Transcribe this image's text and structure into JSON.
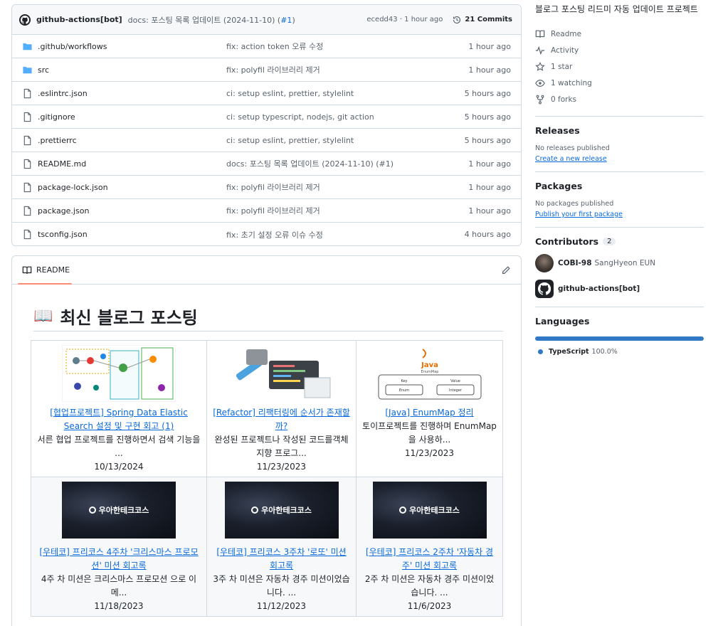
{
  "commit": {
    "author": "github-actions[bot]",
    "message": "docs: 포스팅 목록 업데이트 (2024-11-10) (",
    "pr": "#1",
    "message_end": ")",
    "hash_time": "ecedd43 · 1 hour ago",
    "commits_label": "21 Commits"
  },
  "files": [
    {
      "name": ".github/workflows",
      "type": "folder",
      "message": "fix: action token 오류 수정",
      "time": "1 hour ago"
    },
    {
      "name": "src",
      "type": "folder",
      "message": "fix: polyfil 라이브러리 제거",
      "time": "1 hour ago"
    },
    {
      "name": ".eslintrc.json",
      "type": "file",
      "message": "ci: setup eslint, prettier, stylelint",
      "time": "5 hours ago"
    },
    {
      "name": ".gitignore",
      "type": "file",
      "message": "ci: setup typescript, nodejs, git action",
      "time": "5 hours ago"
    },
    {
      "name": ".prettierrc",
      "type": "file",
      "message": "ci: setup eslint, prettier, stylelint",
      "time": "5 hours ago"
    },
    {
      "name": "README.md",
      "type": "file",
      "message": "docs: 포스팅 목록 업데이트 (2024-11-10) (#1)",
      "time": "1 hour ago"
    },
    {
      "name": "package-lock.json",
      "type": "file",
      "message": "fix: polyfil 라이브러리 제거",
      "time": "1 hour ago"
    },
    {
      "name": "package.json",
      "type": "file",
      "message": "fix: polyfil 라이브러리 제거",
      "time": "1 hour ago"
    },
    {
      "name": "tsconfig.json",
      "type": "file",
      "message": "fix: 초기 설정 오류 이슈 수정",
      "time": "4 hours ago"
    }
  ],
  "readme": {
    "tab_label": "README",
    "book_emoji": "📖",
    "title": "최신 블로그 포스팅",
    "posts": [
      {
        "title": "[협업프로젝트] Spring Data Elastic Search 설정 및 구현 회고 (1)",
        "desc": "서른 협업 프로젝트를 진행하면서 검색 기능을 ...",
        "date": "10/13/2024"
      },
      {
        "title": "[Refactor] 리팩터링에 순서가 존재할까?",
        "desc": "완성된 프로젝트나 작성된 코드를객체지향 프로그...",
        "date": "11/23/2023"
      },
      {
        "title": "[Java] EnumMap 정리",
        "desc": "토이프로젝트를 진행하며 EnumMap을 사용하...",
        "date": "11/23/2023"
      },
      {
        "title": "[우테코] 프리코스 4주차 '크리스마스 프로모션' 미션 회고록",
        "desc": "4주 차 미션은 크리스마스 프로모션 으로 이메...",
        "date": "11/18/2023"
      },
      {
        "title": "[우테코] 프리코스 3주차 '로또' 미션 회고록",
        "desc": "3주 차 미션은 자동차 경주 미션이었습니다. ...",
        "date": "11/12/2023"
      },
      {
        "title": "[우테코] 프리코스 2주차 '자동차 경주' 미션 회고록",
        "desc": "2주 차 미션은 자동차 경주 미션이었습니다. ...",
        "date": "11/6/2023"
      }
    ],
    "banner_text": "우아한테크코스",
    "java_logo": "Java",
    "enummap_labels": {
      "title": "EnumMap",
      "key": "Key",
      "value": "Value",
      "enum": "Enum",
      "integer": "Integer"
    }
  },
  "sidebar": {
    "about": "블로그 포스팅 리드미 자동 업데이트 프로젝트",
    "links": [
      "Readme",
      "Activity",
      "1 star",
      "1 watching",
      "0 forks"
    ],
    "releases": {
      "title": "Releases",
      "empty": "No releases published",
      "link": "Create a new release"
    },
    "packages": {
      "title": "Packages",
      "empty": "No packages published",
      "link": "Publish your first package"
    },
    "contributors": {
      "title": "Contributors",
      "count": "2",
      "people": [
        {
          "login": "COBI-98",
          "name": "SangHyeon EUN"
        },
        {
          "login": "github-actions[bot]",
          "name": ""
        }
      ]
    },
    "languages": {
      "title": "Languages",
      "items": [
        {
          "name": "TypeScript",
          "percent": "100.0%",
          "color": "#3178c6"
        }
      ]
    }
  }
}
